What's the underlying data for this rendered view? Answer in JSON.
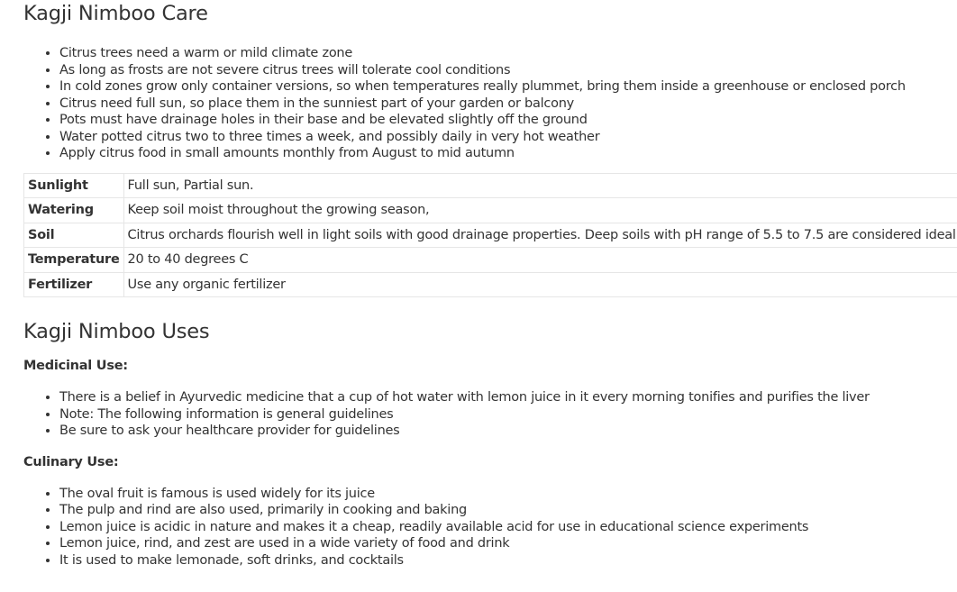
{
  "care": {
    "title": "Kagji Nimboo Care",
    "items": [
      "Citrus trees need a warm or mild climate zone",
      "As long as frosts are not severe citrus trees will tolerate cool conditions",
      "In cold zones grow only container versions, so when temperatures really plummet, bring them inside a greenhouse or enclosed porch",
      "Citrus need full sun, so place them in the sunniest part of your garden or balcony",
      "Pots must have drainage holes in their base and be elevated slightly off the ground",
      "Water potted citrus two to three times a week, and possibly daily in very hot weather",
      "Apply citrus food in small amounts monthly from August to mid autumn"
    ]
  },
  "table": {
    "rows": [
      {
        "key": "Sunlight",
        "value": "Full sun, Partial sun."
      },
      {
        "key": "Watering",
        "value": "Keep soil moist throughout the growing season,"
      },
      {
        "key": "Soil",
        "value": "Citrus orchards flourish well in light soils with good drainage properties. Deep soils with pH range of 5.5 to 7.5 are considered ideal."
      },
      {
        "key": "Temperature",
        "value": "20 to 40 degrees C"
      },
      {
        "key": "Fertilizer",
        "value": "Use any organic fertilizer"
      }
    ]
  },
  "uses": {
    "title": "Kagji Nimboo Uses",
    "medicinal": {
      "heading": "Medicinal Use:",
      "items": [
        "There is a belief in Ayurvedic medicine that a cup of hot water with lemon juice in it every morning tonifies and purifies the liver",
        "Note: The following information is general guidelines",
        "Be sure to ask your healthcare provider for guidelines"
      ]
    },
    "culinary": {
      "heading": "Culinary Use:",
      "items": [
        "The oval fruit is famous is used widely for its juice",
        "The pulp and rind are also used, primarily in cooking and baking",
        "Lemon juice is acidic in nature and makes it a cheap, readily available acid for use in educational science experiments",
        "Lemon juice, rind, and zest are used in a wide variety of food and drink",
        "It is used to make lemonade, soft drinks, and cocktails"
      ]
    }
  }
}
